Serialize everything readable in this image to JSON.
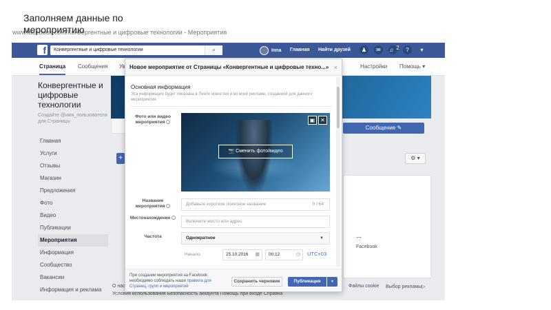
{
  "slide": {
    "title": "Заполняем данные по мероприятию",
    "browser_title": "www.facebook.com/Конвергентные и цифровые технологии - Мероприятия"
  },
  "facebook": {
    "logo": "f",
    "search_value": "Конвергентные и цифровые технологии",
    "user_name": "Inna",
    "nav_home": "Главная",
    "nav_find_friends": "Найти друзей",
    "notification_badge": "2"
  },
  "page_tabs": [
    "Страница",
    "Сообщения",
    "Уведомления",
    "Настройки",
    "Помощь ▾"
  ],
  "page": {
    "name": "Конвергентные и цифровые технологии",
    "handle": "Создайте @имя_пользователя для Страницы",
    "message_button": "Сообщение ✎",
    "right_panel_title": "...",
    "right_panel_text": "Facebook"
  },
  "left_menu": [
    "Главная",
    "Услуги",
    "Отзывы",
    "Магазин",
    "Предложения",
    "Фото",
    "Видео",
    "Публикации",
    "Мероприятия",
    "Информация",
    "Сообщество",
    "Вакансии",
    "Информация и реклама"
  ],
  "left_menu_active_index": 8,
  "footer": {
    "line1": "О нас",
    "line2": "Условия использования   Безопасность аккаунта   Помощь при входе   Справка",
    "cookies": "Файлы cookie",
    "ad_choice": "Выбор рекламы▷"
  },
  "modal": {
    "title": "Новое мероприятие от Страницы «Конвергентные и цифровые техно...»",
    "close": "×",
    "section_title": "Основная информация",
    "section_desc": "Эта информация будет показана в Ленте новостей и во всей рекламе, созданной для данного мероприятия.",
    "photo_label": "Фото или видео мероприятия",
    "change_photo": "Сменить фото/видео",
    "name_label": "Название мероприятия",
    "name_placeholder": "Добавьте короткое понятное название",
    "name_counter": "0 / 64",
    "location_label": "Местонахождение",
    "location_placeholder": "Включите место или адрес",
    "frequency_label": "Частота",
    "frequency_value": "Однократное",
    "start_label": "Начало",
    "start_date": "25.10.2016",
    "start_time": "00:12",
    "timezone": "UTC+03",
    "footer_note": "При создании мероприятия на Facebook необходимо соблюдать наши",
    "footer_link": "правила для Страниц, групп и мероприятий",
    "save_draft": "Сохранить черновик",
    "publish": "Публикация",
    "publish_menu": "▾"
  }
}
